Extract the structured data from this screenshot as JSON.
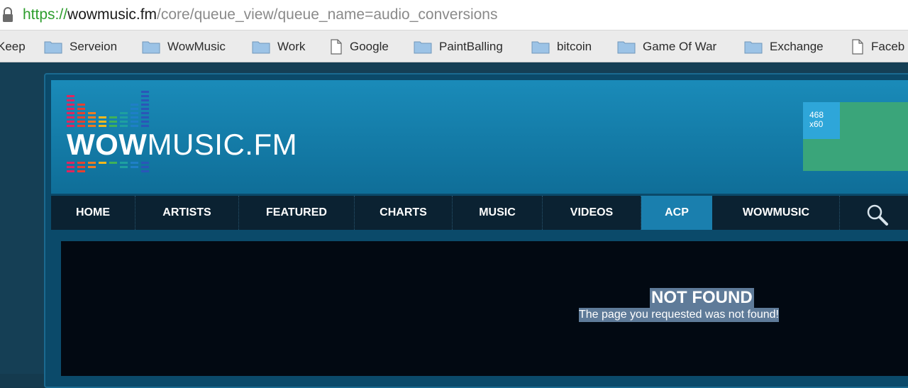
{
  "browser": {
    "url_scheme": "https://",
    "url_host": "wowmusic.fm",
    "url_path": "/core/queue_view/queue_name=audio_conversions",
    "bookmarks": [
      "Keep",
      "Serveion",
      "WowMusic",
      "Work",
      "Google",
      "PaintBalling",
      "bitcoin",
      "Game Of War",
      "Exchange",
      "Faceb"
    ]
  },
  "site": {
    "logo_bold": "WOW",
    "logo_thin": "MUSIC.FM",
    "ad_size": "468\nx60",
    "ad_line1": "468",
    "ad_line2": "x60"
  },
  "nav": {
    "items": [
      "HOME",
      "ARTISTS",
      "FEATURED",
      "CHARTS",
      "MUSIC",
      "VIDEOS",
      "ACP",
      "WOWMUSIC"
    ],
    "active": "ACP"
  },
  "content": {
    "title": "NOT FOUND",
    "message": "The page you requested was not found!"
  },
  "colors": {
    "header": "#1a8bb9",
    "nav": "#0b2232",
    "nav_active": "#1a7fae",
    "ad": "#3aa57a",
    "highlight": "#5f7b99"
  },
  "icons": {
    "lock": "lock-icon",
    "folder": "folder-icon",
    "page": "page-icon",
    "search": "search-icon"
  }
}
